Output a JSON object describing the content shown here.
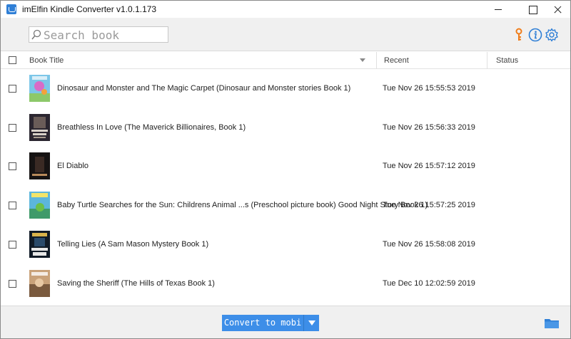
{
  "window": {
    "title": "imElfin Kindle Converter v1.0.1.173"
  },
  "toolbar": {
    "search_placeholder": "Search book",
    "icons": [
      "key-icon",
      "info-icon",
      "gear-icon"
    ]
  },
  "table": {
    "headers": {
      "title": "Book Title",
      "recent": "Recent",
      "status": "Status"
    },
    "rows": [
      {
        "title": "Dinosaur and Monster and The Magic Carpet (Dinosaur and Monster stories Book 1)",
        "recent": "Tue Nov 26 15:55:53 2019",
        "status": ""
      },
      {
        "title": "Breathless In Love (The Maverick Billionaires, Book 1)",
        "recent": "Tue Nov 26 15:56:33 2019",
        "status": ""
      },
      {
        "title": "El Diablo",
        "recent": "Tue Nov 26 15:57:12 2019",
        "status": ""
      },
      {
        "title": "Baby Turtle Searches for the Sun: Childrens Animal ...s (Preschool picture book) Good Night Story Book 1)",
        "recent": "Tue Nov 26 15:57:25 2019",
        "status": ""
      },
      {
        "title": "Telling Lies (A Sam Mason Mystery Book 1)",
        "recent": "Tue Nov 26 15:58:08 2019",
        "status": ""
      },
      {
        "title": "Saving the Sheriff (The Hills of Texas Book 1)",
        "recent": "Tue Dec 10 12:02:59 2019",
        "status": ""
      }
    ]
  },
  "footer": {
    "convert_label": "Convert to mobi",
    "icons": [
      "folder-icon"
    ]
  },
  "colors": {
    "accent": "#3d8ee8",
    "key_icon": "#f07d1a",
    "info_icon": "#2f7fd6"
  }
}
